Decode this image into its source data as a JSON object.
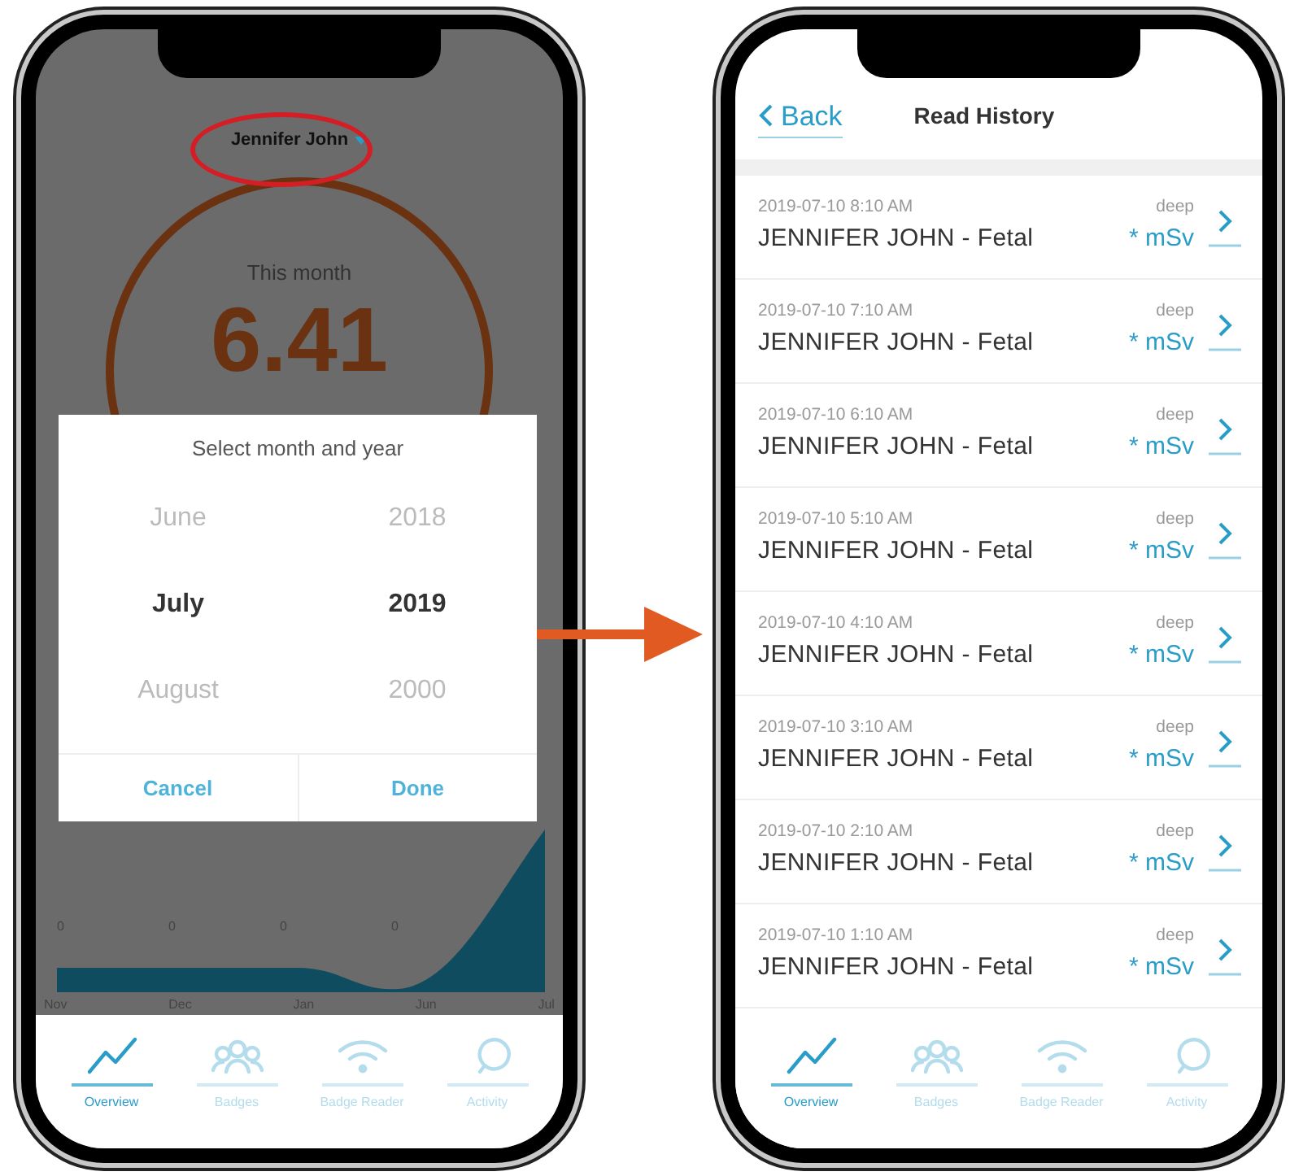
{
  "left_screen": {
    "profile_name": "Jennifer John",
    "summary": {
      "label": "This month",
      "value": "6.41"
    },
    "chart": {
      "value_labels": [
        "0",
        "0",
        "0",
        "0"
      ],
      "x_labels": [
        "Nov",
        "Dec",
        "Jan",
        "Jun",
        "Jul"
      ]
    },
    "dialog": {
      "title": "Select month and year",
      "months": [
        {
          "label": "June",
          "selected": false
        },
        {
          "label": "July",
          "selected": true
        },
        {
          "label": "August",
          "selected": false
        }
      ],
      "years": [
        {
          "label": "2018",
          "selected": false
        },
        {
          "label": "2019",
          "selected": true
        },
        {
          "label": "2000",
          "selected": false
        }
      ],
      "buttons": [
        "Cancel",
        "Done"
      ]
    },
    "tabs": [
      {
        "label": "Overview",
        "kind": "trend",
        "selected": true
      },
      {
        "label": "Badges",
        "kind": "people",
        "selected": false
      },
      {
        "label": "Badge Reader",
        "kind": "wifi",
        "selected": false
      },
      {
        "label": "Activity",
        "kind": "bubble",
        "selected": false
      }
    ]
  },
  "right_screen": {
    "back": "Back",
    "title": "Read History",
    "rows": [
      {
        "time": "2019-07-10 8:10 AM",
        "name": "JENNIFER JOHN - Fetal",
        "type": "deep",
        "dose": "* mSv"
      },
      {
        "time": "2019-07-10 7:10 AM",
        "name": "JENNIFER JOHN - Fetal",
        "type": "deep",
        "dose": "* mSv"
      },
      {
        "time": "2019-07-10 6:10 AM",
        "name": "JENNIFER JOHN - Fetal",
        "type": "deep",
        "dose": "* mSv"
      },
      {
        "time": "2019-07-10 5:10 AM",
        "name": "JENNIFER JOHN - Fetal",
        "type": "deep",
        "dose": "* mSv"
      },
      {
        "time": "2019-07-10 4:10 AM",
        "name": "JENNIFER JOHN - Fetal",
        "type": "deep",
        "dose": "* mSv"
      },
      {
        "time": "2019-07-10 3:10 AM",
        "name": "JENNIFER JOHN - Fetal",
        "type": "deep",
        "dose": "* mSv"
      },
      {
        "time": "2019-07-10 2:10 AM",
        "name": "JENNIFER JOHN - Fetal",
        "type": "deep",
        "dose": "* mSv"
      },
      {
        "time": "2019-07-10 1:10 AM",
        "name": "JENNIFER JOHN - Fetal",
        "type": "deep",
        "dose": "* mSv"
      }
    ],
    "tabs": [
      {
        "label": "Overview",
        "kind": "trend",
        "selected": true
      },
      {
        "label": "Badges",
        "kind": "people",
        "selected": false
      },
      {
        "label": "Badge Reader",
        "kind": "wifi",
        "selected": false
      },
      {
        "label": "Activity",
        "kind": "bubble",
        "selected": false
      }
    ]
  }
}
